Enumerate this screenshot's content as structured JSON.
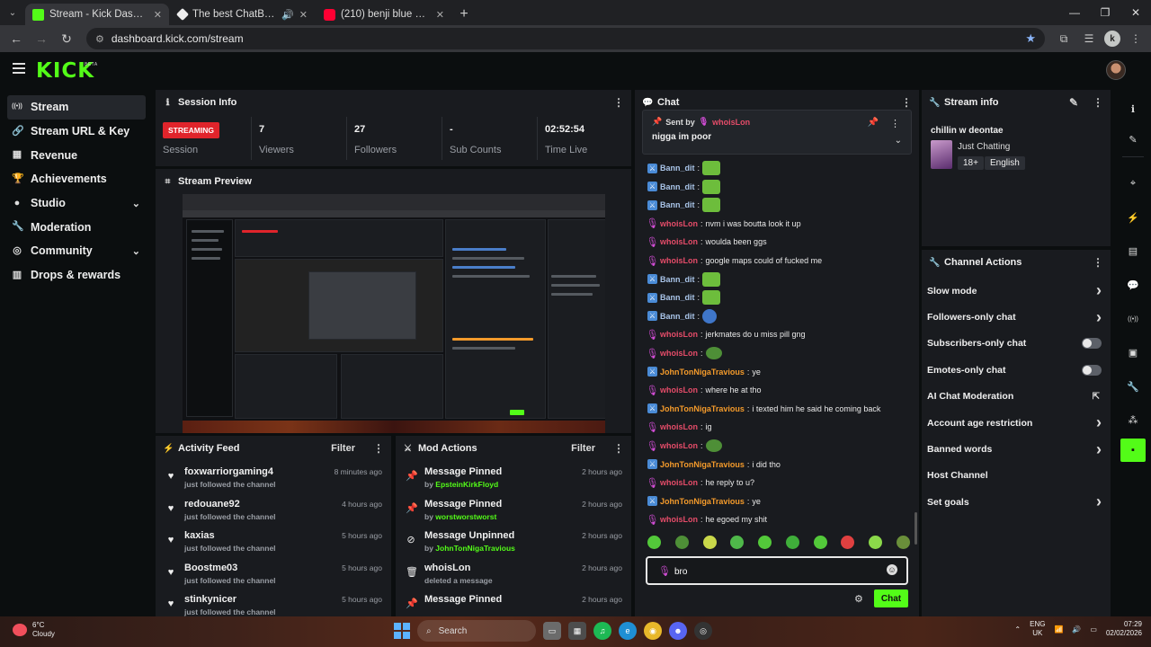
{
  "browser": {
    "tabs": [
      {
        "title": "Stream - Kick Dashboard",
        "fav_color": "#53fc18",
        "active": true
      },
      {
        "title": "The best ChatBot and Widg",
        "fav_color": "#ffffff",
        "active": false
      },
      {
        "title": "(210) benji blue bills - YouTube",
        "fav_color": "#ff0033",
        "active": false
      }
    ],
    "url": "dashboard.kick.com/stream",
    "profile_initial": "k"
  },
  "header": {
    "logo": "KICK",
    "beta": "BETA"
  },
  "sidebar": {
    "items": [
      {
        "label": "Stream",
        "icon": "radio-icon",
        "glyph": "((•))",
        "active": true,
        "chevron": false
      },
      {
        "label": "Stream URL & Key",
        "icon": "link-icon",
        "glyph": "🔗",
        "active": false,
        "chevron": false
      },
      {
        "label": "Revenue",
        "icon": "revenue-icon",
        "glyph": "▦",
        "active": false,
        "chevron": false
      },
      {
        "label": "Achievements",
        "icon": "trophy-icon",
        "glyph": "🏆",
        "active": false,
        "chevron": false
      },
      {
        "label": "Studio",
        "icon": "studio-icon",
        "glyph": "●",
        "active": false,
        "chevron": true
      },
      {
        "label": "Moderation",
        "icon": "wrench-icon",
        "glyph": "🔧",
        "active": false,
        "chevron": false
      },
      {
        "label": "Community",
        "icon": "community-icon",
        "glyph": "◎",
        "active": false,
        "chevron": true
      },
      {
        "label": "Drops & rewards",
        "icon": "drops-icon",
        "glyph": "▥",
        "active": false,
        "chevron": false
      }
    ]
  },
  "session": {
    "title": "Session Info",
    "status_badge": "STREAMING",
    "status_label": "Session",
    "stats": [
      {
        "value": "7",
        "label": "Viewers"
      },
      {
        "value": "27",
        "label": "Followers"
      },
      {
        "value": "-",
        "label": "Sub Counts"
      },
      {
        "value": "02:52:54",
        "label": "Time Live"
      }
    ]
  },
  "preview": {
    "title": "Stream Preview"
  },
  "activity": {
    "title": "Activity Feed",
    "filter": "Filter",
    "items": [
      {
        "name": "foxwarriorgaming4",
        "sub": "just followed the channel",
        "time": "8 minutes ago"
      },
      {
        "name": "redouane92",
        "sub": "just followed the channel",
        "time": "4 hours ago"
      },
      {
        "name": "kaxias",
        "sub": "just followed the channel",
        "time": "5 hours ago"
      },
      {
        "name": "Boostme03",
        "sub": "just followed the channel",
        "time": "5 hours ago"
      },
      {
        "name": "stinkynicer",
        "sub": "just followed the channel",
        "time": "5 hours ago"
      }
    ]
  },
  "mod": {
    "title": "Mod Actions",
    "filter": "Filter",
    "items": [
      {
        "title": "Message Pinned",
        "prefix": "by ",
        "user": "EpsteinKirkFloyd",
        "time": "2 hours ago",
        "icon": "pin-icon",
        "glyph": "📌"
      },
      {
        "title": "Message Pinned",
        "prefix": "by ",
        "user": "worstworstworst",
        "time": "2 hours ago",
        "icon": "pin-icon",
        "glyph": "📌"
      },
      {
        "title": "Message Unpinned",
        "prefix": "by ",
        "user": "JohnTonNigaTravious",
        "time": "2 hours ago",
        "icon": "unpin-icon",
        "glyph": "⊘"
      },
      {
        "title": "whoisLon",
        "prefix": "deleted a message",
        "user": "",
        "time": "2 hours ago",
        "icon": "trash-icon",
        "glyph": "🗑"
      },
      {
        "title": "Message Pinned",
        "prefix": "",
        "user": "",
        "time": "2 hours ago",
        "icon": "pin-icon",
        "glyph": "📌"
      }
    ]
  },
  "chat": {
    "title": "Chat",
    "pinned": {
      "sent_by": "Sent by",
      "user": "whoisLon",
      "message": "nigga im poor"
    },
    "messages": [
      {
        "user": "Bann_dit",
        "color": "blue",
        "badge": "mod",
        "text": "",
        "emote": "green"
      },
      {
        "user": "Bann_dit",
        "color": "blue",
        "badge": "mod",
        "text": "",
        "emote": "green"
      },
      {
        "user": "Bann_dit",
        "color": "blue",
        "badge": "mod",
        "text": "",
        "emote": "green"
      },
      {
        "user": "whoisLon",
        "color": "red",
        "badge": "mic",
        "text": "nvm i was boutta look it up",
        "emote": ""
      },
      {
        "user": "whoisLon",
        "color": "red",
        "badge": "mic",
        "text": "woulda been ggs",
        "emote": ""
      },
      {
        "user": "whoisLon",
        "color": "red",
        "badge": "mic",
        "text": "google maps could of fucked me",
        "emote": ""
      },
      {
        "user": "Bann_dit",
        "color": "blue",
        "badge": "mod",
        "text": "",
        "emote": "green"
      },
      {
        "user": "Bann_dit",
        "color": "blue",
        "badge": "mod",
        "text": "",
        "emote": "green"
      },
      {
        "user": "Bann_dit",
        "color": "blue",
        "badge": "mod",
        "text": "",
        "emote": "blue"
      },
      {
        "user": "whoisLon",
        "color": "red",
        "badge": "mic",
        "text": "jerkmates do u miss pill gng",
        "emote": ""
      },
      {
        "user": "whoisLon",
        "color": "red",
        "badge": "mic",
        "text": "",
        "emote": "pepe"
      },
      {
        "user": "JohnTonNigaTravious",
        "color": "orange",
        "badge": "mod",
        "text": "ye",
        "emote": ""
      },
      {
        "user": "whoisLon",
        "color": "red",
        "badge": "mic",
        "text": "where he at tho",
        "emote": ""
      },
      {
        "user": "JohnTonNigaTravious",
        "color": "orange",
        "badge": "mod",
        "text": "i texted him he said he coming back",
        "emote": ""
      },
      {
        "user": "whoisLon",
        "color": "red",
        "badge": "mic",
        "text": "ig",
        "emote": ""
      },
      {
        "user": "whoisLon",
        "color": "red",
        "badge": "mic",
        "text": "",
        "emote": "pepe"
      },
      {
        "user": "JohnTonNigaTravious",
        "color": "orange",
        "badge": "mod",
        "text": "i did tho",
        "emote": ""
      },
      {
        "user": "whoisLon",
        "color": "red",
        "badge": "mic",
        "text": "he reply to u?",
        "emote": ""
      },
      {
        "user": "JohnTonNigaTravious",
        "color": "orange",
        "badge": "mod",
        "text": "ye",
        "emote": ""
      },
      {
        "user": "whoisLon",
        "color": "red",
        "badge": "mic",
        "text": "he egoed my shit",
        "emote": ""
      }
    ],
    "emote_colors": [
      "#53c93a",
      "#4e8f37",
      "#c9d84a",
      "#4fb84a",
      "#53c93a",
      "#3fae3a",
      "#53c93a",
      "#e04040",
      "#8bd84a",
      "#6a8f3a"
    ],
    "input_value": "bro",
    "send_label": "Chat"
  },
  "stream_info": {
    "title": "Stream info",
    "stream_title": "chillin w deontae",
    "category": "Just Chatting",
    "tags": [
      "18+",
      "English"
    ]
  },
  "channel_actions": {
    "title": "Channel Actions",
    "items": [
      {
        "label": "Slow mode",
        "control": "chevron"
      },
      {
        "label": "Followers-only chat",
        "control": "chevron"
      },
      {
        "label": "Subscribers-only chat",
        "control": "toggle"
      },
      {
        "label": "Emotes-only chat",
        "control": "toggle"
      },
      {
        "label": "AI Chat Moderation",
        "control": "external"
      },
      {
        "label": "Account age restriction",
        "control": "chevron"
      },
      {
        "label": "Banned words",
        "control": "chevron"
      },
      {
        "label": "Host Channel",
        "control": "none"
      },
      {
        "label": "Set goals",
        "control": "chevron"
      }
    ]
  },
  "rail": {
    "buttons": [
      {
        "icon": "info-icon",
        "glyph": "ℹ"
      },
      {
        "icon": "edit-icon",
        "glyph": "✎"
      },
      {
        "icon": "target-icon",
        "glyph": "⌖"
      },
      {
        "icon": "bolt-icon",
        "glyph": "⚡"
      },
      {
        "icon": "document-icon",
        "glyph": "▤"
      },
      {
        "icon": "chat-bubble-icon",
        "glyph": "💬"
      },
      {
        "icon": "broadcast-icon",
        "glyph": "((•))"
      },
      {
        "icon": "layout-icon",
        "glyph": "▣"
      },
      {
        "icon": "wrench-icon",
        "glyph": "🔧"
      },
      {
        "icon": "nodes-icon",
        "glyph": "⁂"
      },
      {
        "icon": "bot-icon",
        "glyph": "▪"
      }
    ]
  },
  "taskbar": {
    "weather_temp": "6°C",
    "weather_desc": "Cloudy",
    "search": "Search",
    "lang_top": "ENG",
    "lang_bottom": "UK",
    "time": "07:29",
    "date": "02/02/2026"
  }
}
